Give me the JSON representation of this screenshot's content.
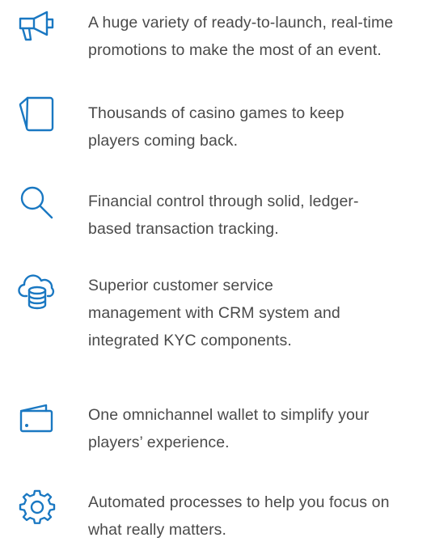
{
  "theme": {
    "accent": "#1a78c2",
    "text_color": "#4a4a4a"
  },
  "features": [
    {
      "icon": "megaphone-icon",
      "lines": [
        "A huge variety of ready-to-launch, real-time",
        "promotions to make the most of an event."
      ]
    },
    {
      "icon": "cards-icon",
      "lines": [
        "Thousands of casino games to keep",
        "players coming back."
      ]
    },
    {
      "icon": "search-icon",
      "lines": [
        "Financial control through solid, ledger-",
        "based transaction tracking."
      ]
    },
    {
      "icon": "cloud-database-icon",
      "lines": [
        "Superior customer service",
        "management with CRM system and",
        "integrated KYC components."
      ]
    },
    {
      "icon": "wallet-icon",
      "lines": [
        "One omnichannel wallet to simplify your",
        "players’ experience."
      ]
    },
    {
      "icon": "gear-icon",
      "lines": [
        "Automated processes to help you focus on",
        "what really matters."
      ]
    }
  ]
}
